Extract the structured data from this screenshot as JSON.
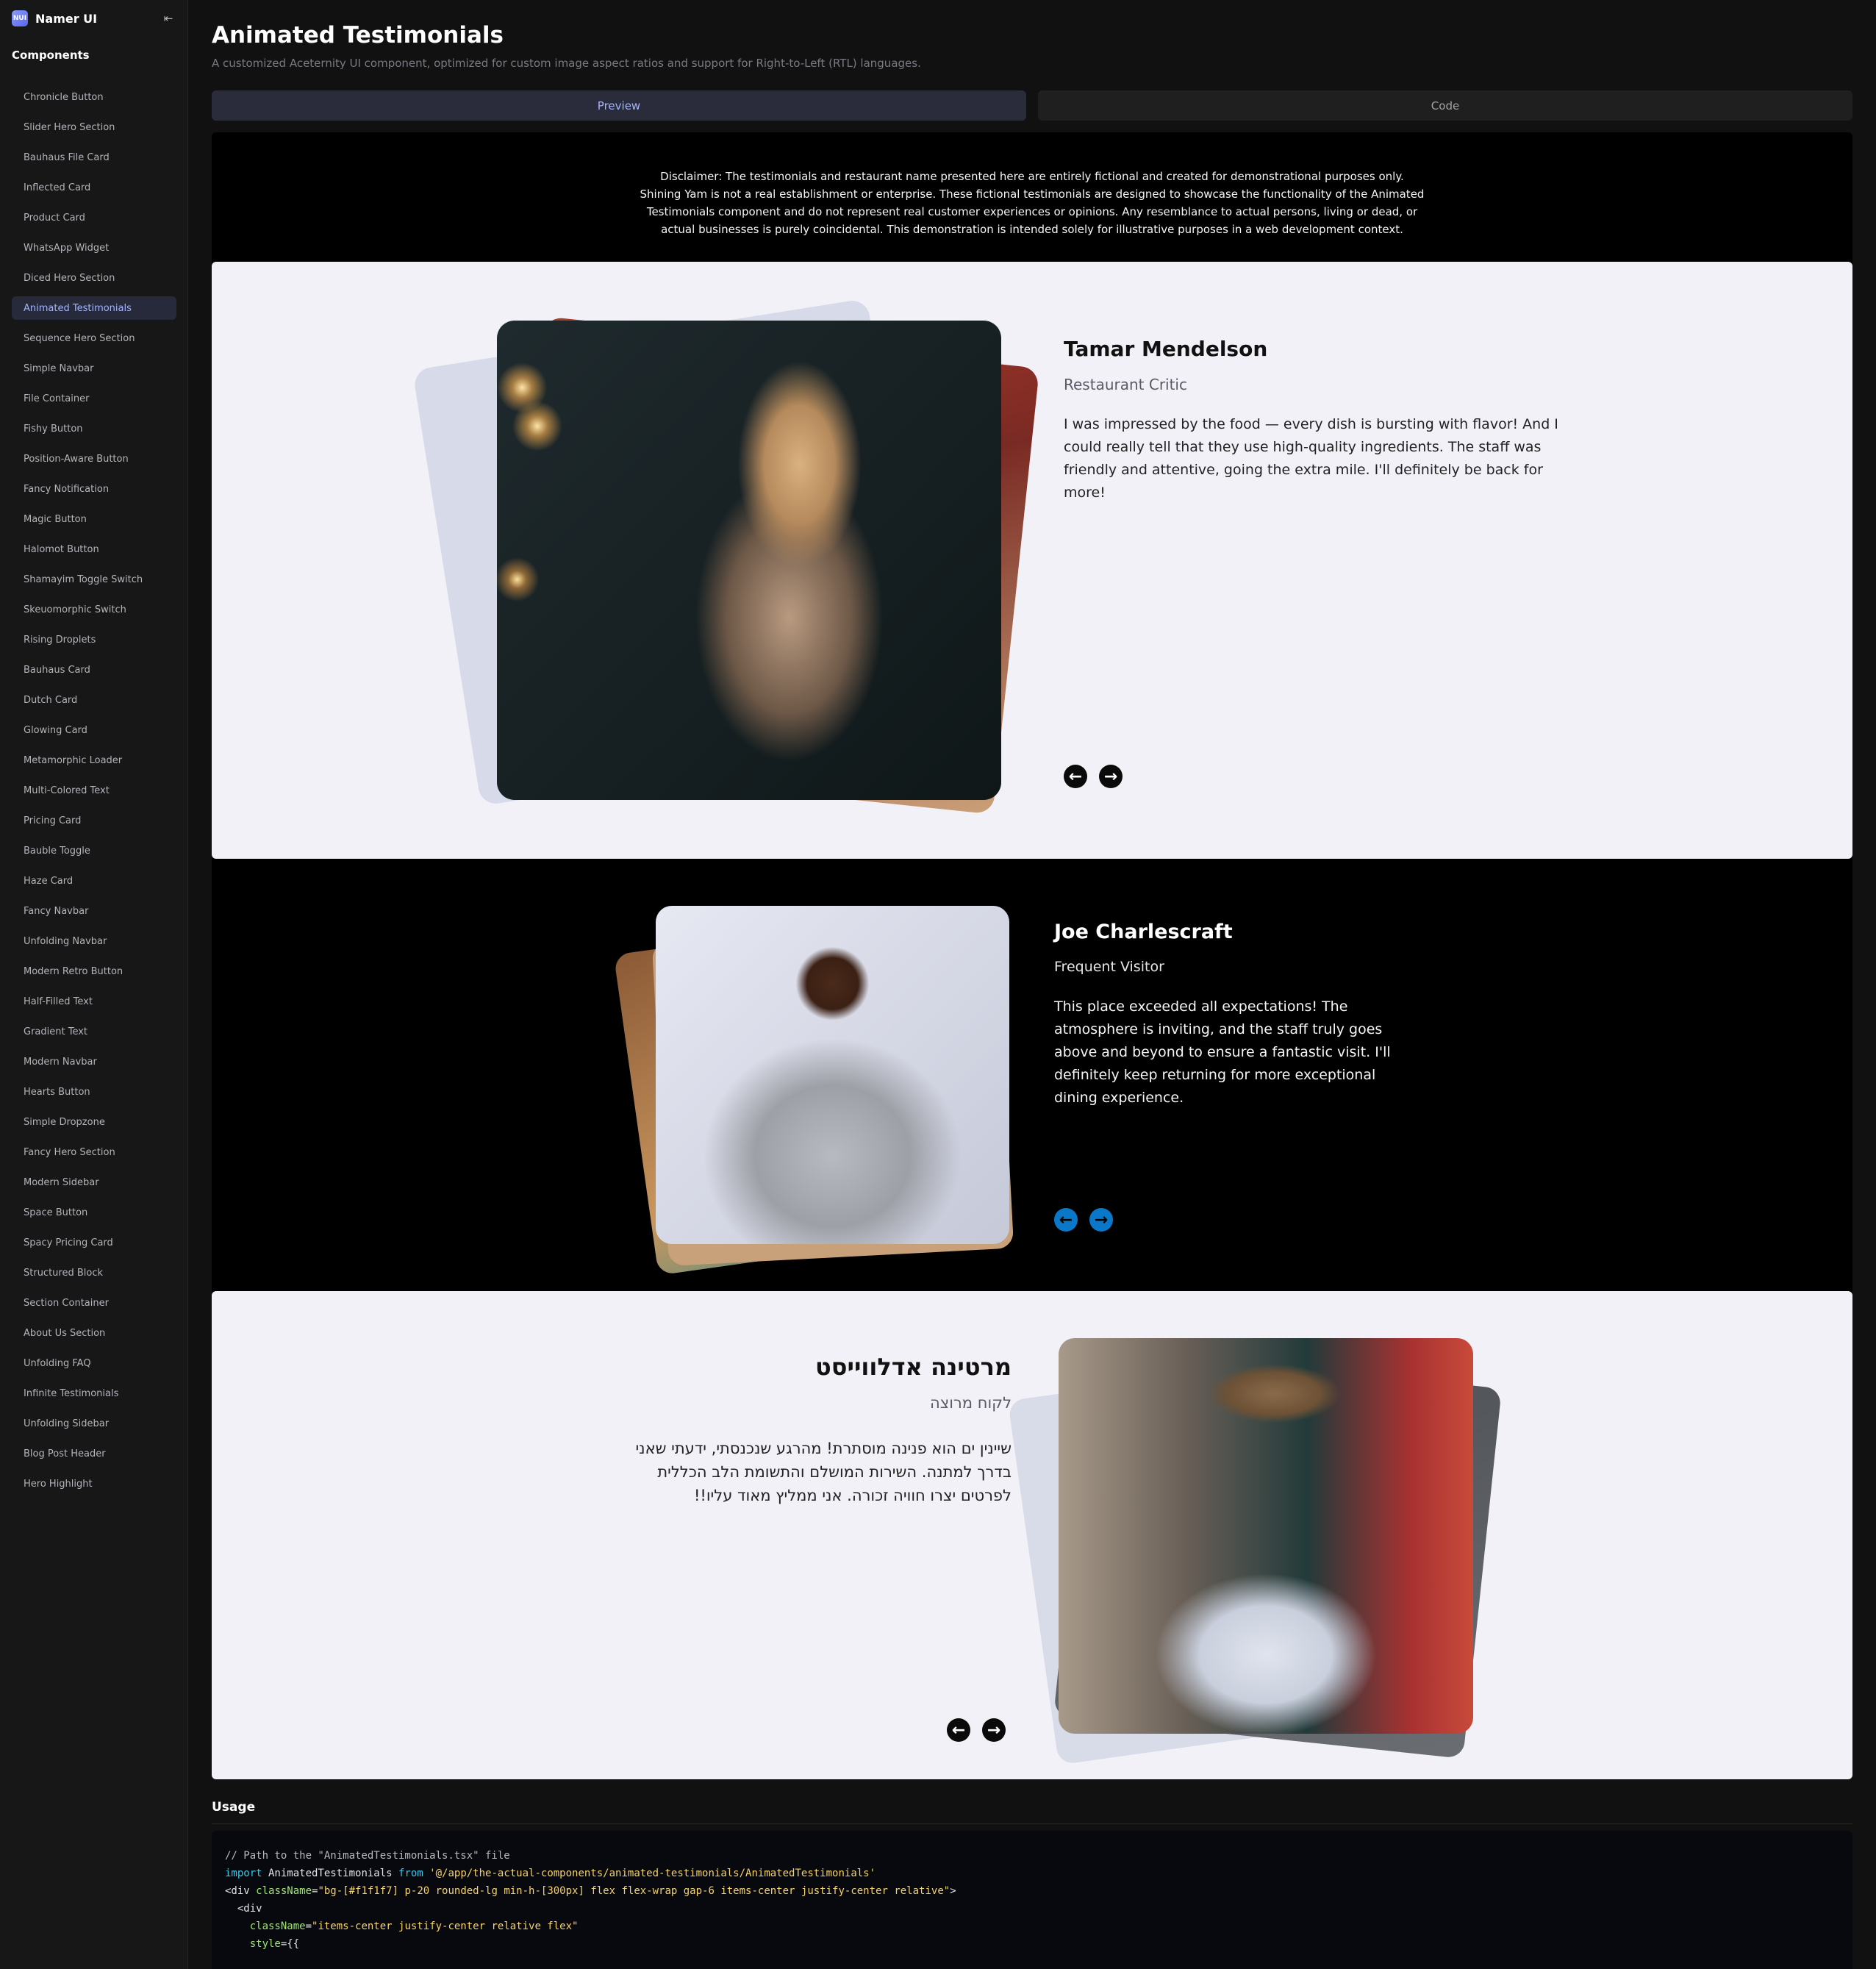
{
  "sidebar": {
    "brand_logo": "NUI",
    "brand_name": "Namer UI",
    "section_label": "Components",
    "items": [
      "Chronicle Button",
      "Slider Hero Section",
      "Bauhaus File Card",
      "Inflected Card",
      "Product Card",
      "WhatsApp Widget",
      "Diced Hero Section",
      "Animated Testimonials",
      "Sequence Hero Section",
      "Simple Navbar",
      "File Container",
      "Fishy Button",
      "Position-Aware Button",
      "Fancy Notification",
      "Magic Button",
      "Halomot Button",
      "Shamayim Toggle Switch",
      "Skeuomorphic Switch",
      "Rising Droplets",
      "Bauhaus Card",
      "Dutch Card",
      "Glowing Card",
      "Metamorphic Loader",
      "Multi-Colored Text",
      "Pricing Card",
      "Bauble Toggle",
      "Haze Card",
      "Fancy Navbar",
      "Unfolding Navbar",
      "Modern Retro Button",
      "Half-Filled Text",
      "Gradient Text",
      "Modern Navbar",
      "Hearts Button",
      "Simple Dropzone",
      "Fancy Hero Section",
      "Modern Sidebar",
      "Space Button",
      "Spacy Pricing Card",
      "Structured Block",
      "Section Container",
      "About Us Section",
      "Unfolding FAQ",
      "Infinite Testimonials",
      "Unfolding Sidebar",
      "Blog Post Header",
      "Hero Highlight"
    ],
    "active_item": "Animated Testimonials"
  },
  "header": {
    "title": "Animated Testimonials",
    "subtitle": "A customized Aceternity UI component, optimized for custom image aspect ratios and support for Right-to-Left (RTL) languages."
  },
  "tabs": {
    "preview": "Preview",
    "code": "Code",
    "active": "Preview"
  },
  "disclaimer": "Disclaimer: The testimonials and restaurant name presented here are entirely fictional and created for demonstrational purposes only. Shining Yam is not a real establishment or enterprise. These fictional testimonials are designed to showcase the functionality of the Animated Testimonials component and do not represent real customer experiences or opinions. Any resemblance to actual persons, living or dead, or actual businesses is purely coincidental. This demonstration is intended solely for illustrative purposes in a web development context.",
  "testimonials": [
    {
      "name": "Tamar Mendelson",
      "role": "Restaurant Critic",
      "quote": "I was impressed by the food — every dish is bursting with flavor! And I could really tell that they use high-quality ingredients. The staff was friendly and attentive, going the extra mile. I'll definitely be back for more!",
      "theme": "light",
      "arrow_color": "#0a0a0a"
    },
    {
      "name": "Joe Charlescraft",
      "role": "Frequent Visitor",
      "quote": "This place exceeded all expectations! The atmosphere is inviting, and the staff truly goes above and beyond to ensure a fantastic visit. I'll definitely keep returning for more exceptional dining experience.",
      "theme": "dark",
      "arrow_color": "#0a78c8"
    },
    {
      "name": "מרטינה אדלווייסט",
      "role": "לקוח מרוצה",
      "quote": "שיינין ים הוא פנינה מוסתרת! מהרגע שנכנסתי, ידעתי שאני בדרך למתנה. השירות המושלם והתשומת הלב הכללית לפרטים יצרו חוויה זכורה. אני ממליץ מאוד עליו!!",
      "theme": "light",
      "direction": "rtl",
      "arrow_color": "#0a0a0a"
    }
  ],
  "icons": {
    "prev": "arrow-left-icon",
    "next": "arrow-right-icon",
    "collapse": "sidebar-collapse-icon"
  },
  "usage": {
    "title": "Usage",
    "lines": [
      "// Path to the \"AnimatedTestimonials.tsx\" file",
      "import AnimatedTestimonials from '@/app/the-actual-components/animated-testimonials/AnimatedTestimonials'",
      "",
      "<div className=\"bg-[#f1f1f7] p-20 rounded-lg min-h-[300px] flex flex-wrap gap-6 items-center justify-center relative\">",
      "  <div",
      "    className=\"items-center justify-center relative flex\"",
      "    style={{"
    ]
  },
  "colors": {
    "background": "#111111",
    "sidebar": "#171717",
    "accent": "#a5b4fc",
    "panel_light": "#f1f1f7",
    "panel_dark": "#000000",
    "arrow_blue": "#0a78c8"
  }
}
